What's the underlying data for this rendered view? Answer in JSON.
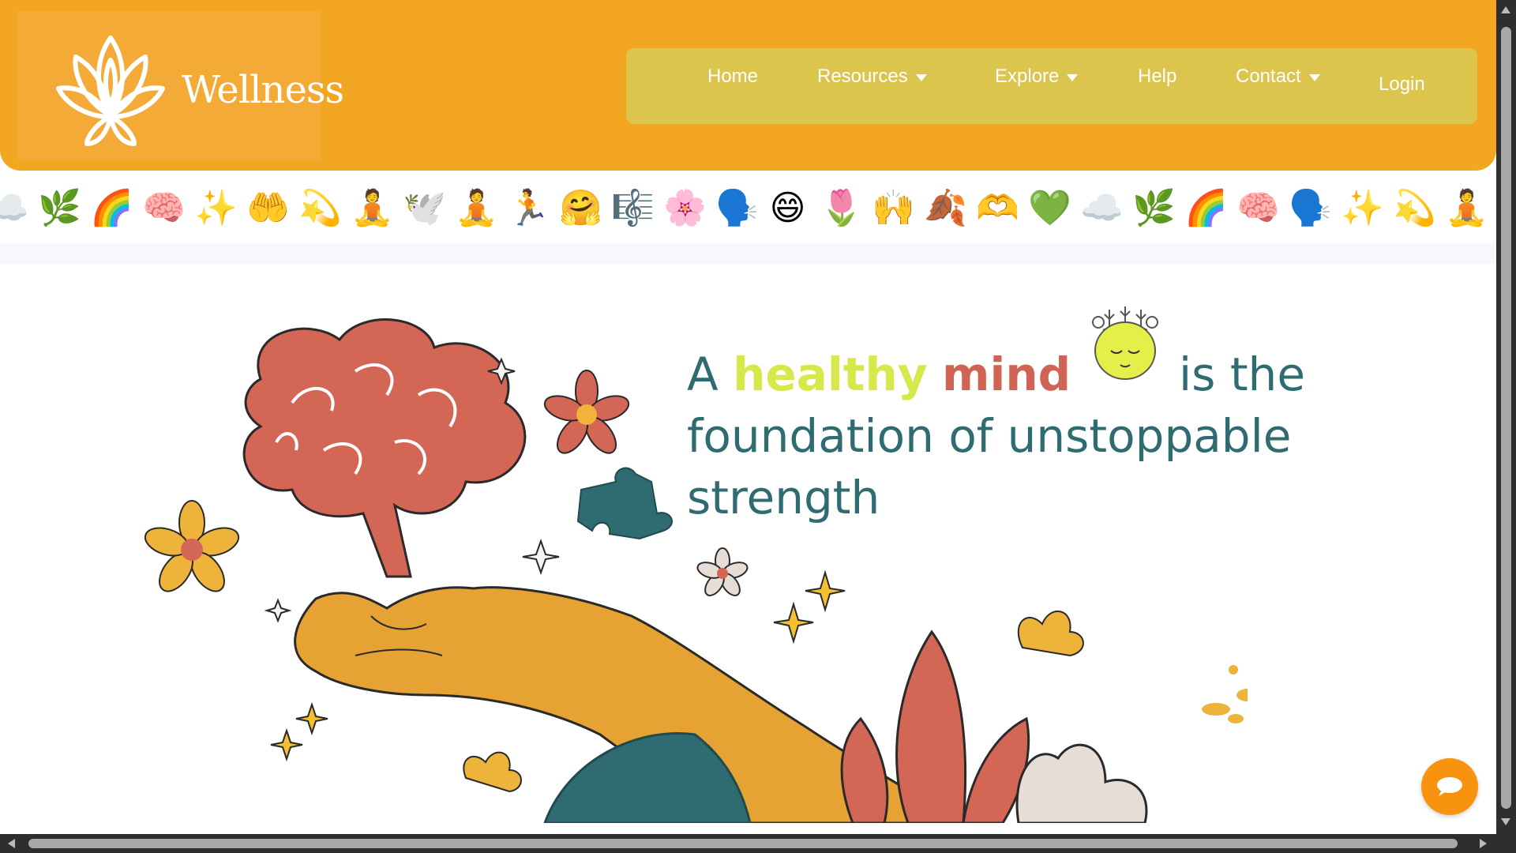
{
  "brand": {
    "name": "Wellness",
    "logo_icon": "lotus-icon"
  },
  "nav": {
    "home": "Home",
    "resources": "Resources",
    "explore": "Explore",
    "help": "Help",
    "contact": "Contact",
    "login": "Login"
  },
  "emoji_strip": [
    "☁️",
    "🌿",
    "🌈",
    "🧠",
    "✨",
    "🤲",
    "💫",
    "🧘",
    "🕊️",
    "🧘",
    "🏃",
    "🤗",
    "🎼",
    "🌸",
    "🗣️",
    "😄",
    "🌷",
    "🙌",
    "🍂",
    "🫶",
    "💚",
    "☁️",
    "🌿",
    "🌈",
    "🧠",
    "🗣️",
    "✨",
    "💫",
    "🧘"
  ],
  "hero": {
    "word_a": "A",
    "word_healthy": "healthy",
    "word_mind": "mind",
    "rest_line1": "is the",
    "rest_line2": "foundation of unstoppable",
    "rest_line3": "strength"
  },
  "chat": {
    "icon": "chat-bubble-icon"
  },
  "colors": {
    "header": "#f2a622",
    "nav": "#dbc54d",
    "headline": "#2f6c72",
    "healthy": "#d6e84a",
    "mind": "#cf6454",
    "chat": "#f7930e"
  }
}
